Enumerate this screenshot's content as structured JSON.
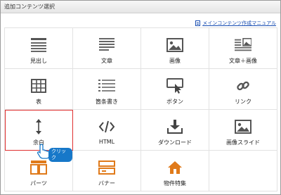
{
  "dialog": {
    "title": "追加コンテンツ選択",
    "manual_link": "メインコンテンツ作成マニュアル"
  },
  "items": [
    {
      "label": "見出し",
      "icon": "heading-icon"
    },
    {
      "label": "文章",
      "icon": "text-icon"
    },
    {
      "label": "画像",
      "icon": "image-icon"
    },
    {
      "label": "文章＋画像",
      "icon": "text-image-icon"
    },
    {
      "label": "表",
      "icon": "table-icon"
    },
    {
      "label": "箇条書き",
      "icon": "list-icon"
    },
    {
      "label": "ボタン",
      "icon": "button-icon"
    },
    {
      "label": "リンク",
      "icon": "link-icon"
    },
    {
      "label": "余白",
      "icon": "spacing-icon"
    },
    {
      "label": "HTML",
      "icon": "code-icon"
    },
    {
      "label": "ダウンロード",
      "icon": "download-icon"
    },
    {
      "label": "画像スライド",
      "icon": "slideshow-icon"
    },
    {
      "label": "パーツ",
      "icon": "parts-icon"
    },
    {
      "label": "バナー",
      "icon": "banner-icon"
    },
    {
      "label": "物件特集",
      "icon": "house-icon"
    }
  ],
  "tooltip": {
    "label": "クリック"
  },
  "colors": {
    "accent": "#e07a1a",
    "link": "#1a4fb3",
    "selection": "#e03030",
    "tooltip": "#1778c9"
  }
}
